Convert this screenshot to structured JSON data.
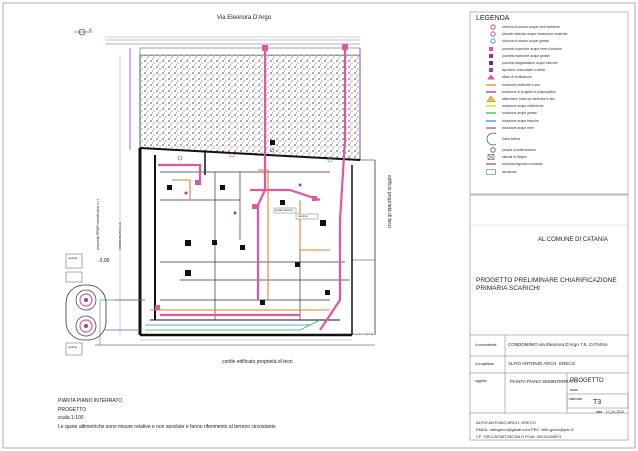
{
  "drawing": {
    "street_label": "Via Eleonora D'Argo",
    "courtyard_label": "cortile edificato proprietà di terzi",
    "building_label_right": "edificio proprietà di terzi",
    "property_label_left": "proprietà PROFI beneficiario s.r.l.",
    "wall_label_left": "cordolo muro in c.a.",
    "level_label": "-3,00",
    "room_labels": [
      "locale tecnico",
      "cantina",
      "cantina",
      "cantina"
    ],
    "bottom_right_note": "corte esterna di proprietà",
    "north_label": "N"
  },
  "legend": {
    "title": "LEGENDA",
    "items": [
      {
        "symbol": "circle-red",
        "color": "#c0392b",
        "label": "colonna di scarico acque nere esistente"
      },
      {
        "symbol": "circle-purple",
        "color": "#8e44ad",
        "label": "pluviale interrato acque meteoriche esistente"
      },
      {
        "symbol": "circle-green",
        "color": "#27ae60",
        "label": "colonna di scarico acque grasse"
      },
      {
        "symbol": "square-pink",
        "color": "#e056a0",
        "label": "pozzetto ispezione acque nere e bianche"
      },
      {
        "symbol": "square-magenta",
        "color": "#b0306a",
        "label": "pozzetto ispezione acque grasse"
      },
      {
        "symbol": "square-purple",
        "color": "#6c2a8a",
        "label": "pozzetto disgrassatore acque bianche"
      },
      {
        "symbol": "square-small",
        "color": "#8e44ad",
        "label": "ispezione orizzontale a sifone"
      },
      {
        "symbol": "triangle-pink",
        "color": "#e056a0",
        "label": "sfiato di ventilazione"
      },
      {
        "symbol": "line-orange",
        "color": "#e67e22",
        "label": "tubazione esistente in pvc"
      },
      {
        "symbol": "line-magenta",
        "color": "#c71585",
        "label": "tubazione di progetto in polipropilene"
      },
      {
        "symbol": "line-warn",
        "color": "#f1c40f",
        "label": "attenzione: tratto da verificare in sito"
      },
      {
        "symbol": "line-yellow",
        "color": "#e6c200",
        "label": "tubazione acque meteoriche"
      },
      {
        "symbol": "line-green",
        "color": "#27ae60",
        "label": "tubazione acque grasse"
      },
      {
        "symbol": "line-blue",
        "color": "#2e86de",
        "label": "tubazione acque bianche"
      },
      {
        "symbol": "line-purple",
        "color": "#8e44ad",
        "label": "tubazione acque nere"
      },
      {
        "symbol": "circle-big",
        "color": "#555555",
        "label": "fossa settica"
      },
      {
        "symbol": "circle-pump",
        "color": "#555555",
        "label": "pompa di sollevamento"
      },
      {
        "symbol": "box-x",
        "color": "#333333",
        "label": "valvola di ritegno"
      },
      {
        "symbol": "line-red",
        "color": "#c0392b",
        "label": "condotta fognaria comunale"
      },
      {
        "symbol": "rect-hatch",
        "color": "#555555",
        "label": "aerazione"
      }
    ]
  },
  "title_block": {
    "authority": "AL COMUNE DI CATANIA",
    "project_title": "PROGETTO PRELIMINARE CHIARIFICAZIONE PRIMARIA SCARICHI",
    "client_label": "il committente",
    "client_value": "CONDOMINIO via Eleonora D'Argo 7,9, CATANIA",
    "designer_label": "il progettista",
    "designer_value": "ALFIO ANTONIO ARCH. GRECO",
    "subject_label": "oggetto",
    "subject_value": "PIANTA PIANO SEMINTERRATO",
    "phase_label": "PROGETTO",
    "scale_label": "scala",
    "table_label": "elaborato",
    "table_value": "T3",
    "date_label": "data",
    "date_value": "17_04_2015",
    "contact_name": "ALFIO ANTONIO ARCH. GRECO",
    "contact_email": "EMAIL: alfiogreco@gmail.com PEC: alfio.greco@pec.it",
    "contact_cf": "CF: GRCLNT68T15C351O   P.IVA: 05210100874"
  },
  "notes": {
    "line1": "PIANTA PIANO INTERRATO",
    "line2": "PROGETTO",
    "line3": "scala 1:100",
    "line4": "Le quote altimetriche sono misure relative e non assolute e fanno riferimento al terreno circostante"
  }
}
